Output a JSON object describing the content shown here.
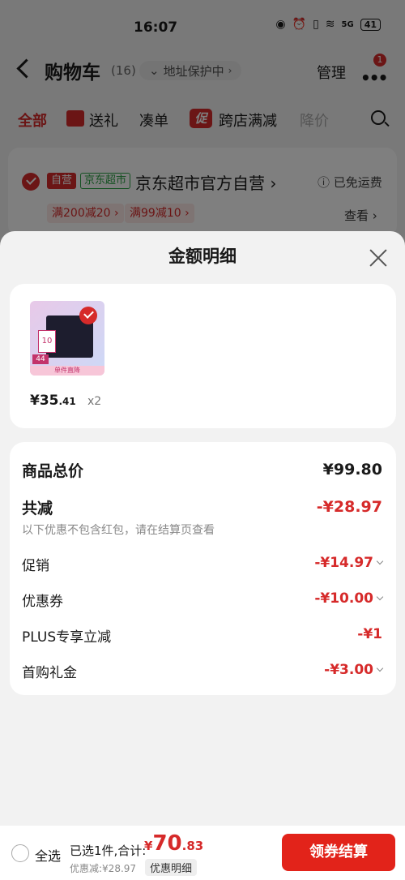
{
  "status": {
    "time": "16:07",
    "battery": "41",
    "signal": "5G"
  },
  "nav": {
    "title": "购物车",
    "count": "(16)",
    "address_pill": "地址保护中",
    "manage": "管理",
    "badge": "1"
  },
  "tabs": [
    {
      "label": "全部"
    },
    {
      "label": "送礼"
    },
    {
      "label": "凑单"
    },
    {
      "label": "跨店满减"
    },
    {
      "label": "降价"
    }
  ],
  "store": {
    "tag_self": "自营",
    "tag_super": "京东超市",
    "name": "京东超市官方自营",
    "freeship": "已免运费",
    "coupons": [
      "满200减20",
      "满99减10"
    ],
    "view_more": "查看"
  },
  "sheet": {
    "title": "金额明细",
    "product": {
      "price_main": "¥35",
      "price_cents": ".41",
      "qty": "x2",
      "img_label": "10",
      "img_bar": "单件直降",
      "img_price": "44"
    },
    "rows": {
      "total_label": "商品总价",
      "total_value": "¥99.80",
      "reduce_label": "共减",
      "reduce_value": "-¥28.97",
      "reduce_note": "以下优惠不包含红包，请在结算页查看",
      "promo_label": "促销",
      "promo_value": "-¥14.97",
      "coupon_label": "优惠券",
      "coupon_value": "-¥10.00",
      "plus_label": "PLUS专享立减",
      "plus_value": "-¥1",
      "first_label": "首购礼金",
      "first_value": "-¥3.00"
    }
  },
  "bottom": {
    "select_all": "全选",
    "selected": "已选1件,合计:",
    "currency": "¥",
    "total_main": "70",
    "total_cents": ".83",
    "saved": "优惠减:¥28.97",
    "detail_pill": "优惠明细",
    "checkout": "领券结算"
  },
  "colors": {
    "accent": "#d62a2a",
    "green": "#2ba245"
  }
}
